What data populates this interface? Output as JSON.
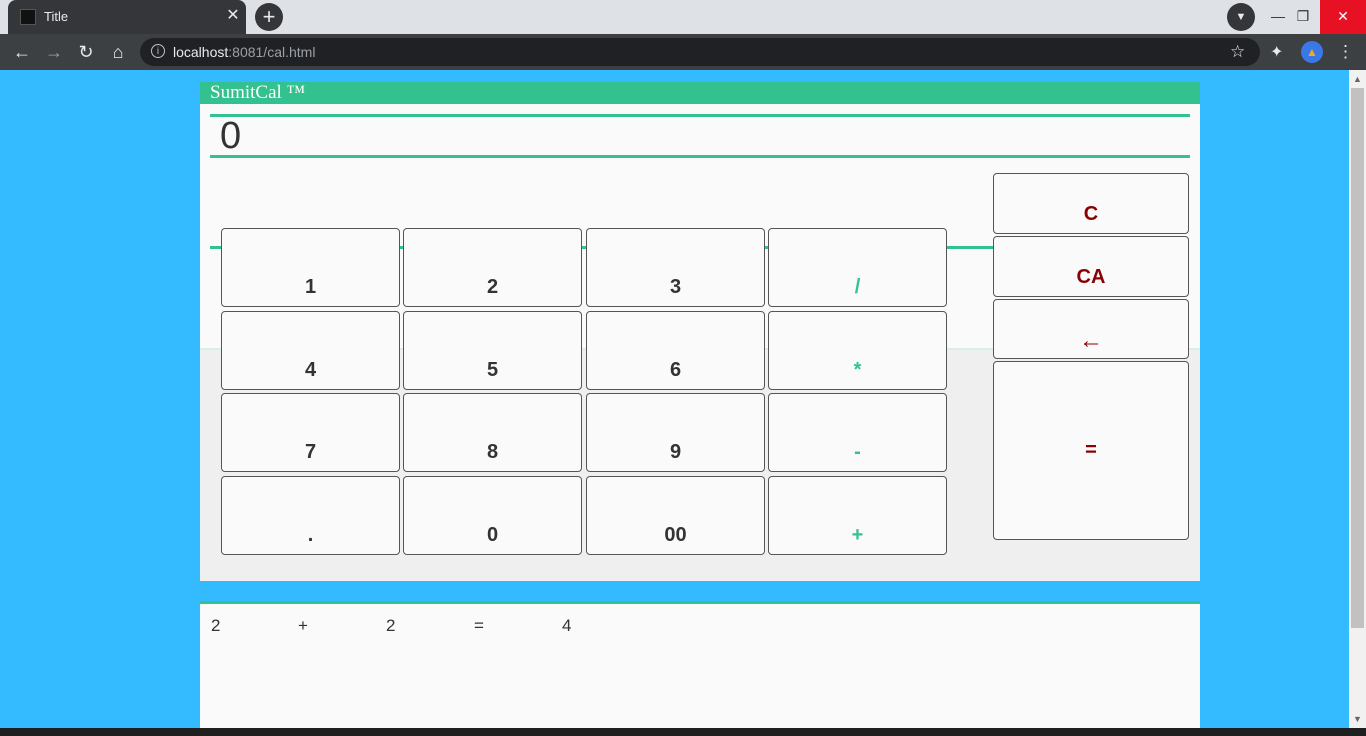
{
  "browser": {
    "tab_title": "Title",
    "tab_close": "✕",
    "new_tab": "+",
    "url_host": "localhost",
    "url_rest": ":8081/cal.html",
    "icons": [
      "back-arrow-icon",
      "forward-arrow-icon",
      "reload-icon",
      "home-icon",
      "info-icon",
      "star-icon",
      "extensions-icon",
      "profile-icon",
      "menu-icon"
    ]
  },
  "window": {
    "minimize": "—",
    "maximize": "❐",
    "close": "✕"
  },
  "calculator": {
    "title": "SumitCal ™",
    "display": "0",
    "keys": [
      {
        "label": "1",
        "type": "digit"
      },
      {
        "label": "2",
        "type": "digit"
      },
      {
        "label": "3",
        "type": "digit"
      },
      {
        "label": "/",
        "type": "operator"
      },
      {
        "label": "4",
        "type": "digit"
      },
      {
        "label": "5",
        "type": "digit"
      },
      {
        "label": "6",
        "type": "digit"
      },
      {
        "label": "*",
        "type": "operator"
      },
      {
        "label": "7",
        "type": "digit"
      },
      {
        "label": "8",
        "type": "digit"
      },
      {
        "label": "9",
        "type": "digit"
      },
      {
        "label": "-",
        "type": "operator"
      },
      {
        "label": ".",
        "type": "digit"
      },
      {
        "label": "0",
        "type": "digit"
      },
      {
        "label": "00",
        "type": "digit"
      },
      {
        "label": "+",
        "type": "operator"
      }
    ],
    "side_keys": {
      "clear": "C",
      "clear_all": "CA",
      "backspace": "←",
      "equals": "="
    },
    "colors": {
      "accent": "#32c18f",
      "page_bg": "#33baff",
      "control_text": "#8b0000"
    }
  },
  "history": [
    {
      "operand1": "2",
      "operator": "+",
      "operand2": "2",
      "equals": "=",
      "result": "4"
    }
  ]
}
